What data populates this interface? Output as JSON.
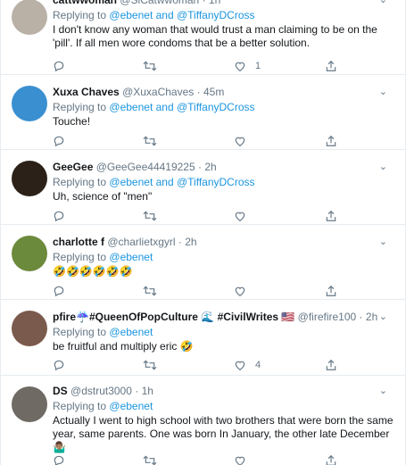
{
  "tweets": [
    {
      "name": "cattwwoman",
      "handle": "@SiCatwwoman",
      "time": "1h",
      "reply_prefix": "Replying to",
      "reply_mentions": "@ebenet and @TiffanyDCross",
      "text": "I don't know any woman that would trust a man claiming to be on the 'pill'. If all men wore condoms that be a better solution.",
      "likes": "1",
      "avatar_color": "#b9b0a6"
    },
    {
      "name": "Xuxa Chaves",
      "handle": "@XuxaChaves",
      "time": "45m",
      "reply_prefix": "Replying to",
      "reply_mentions": "@ebenet and @TiffanyDCross",
      "text": "Touche!",
      "likes": "",
      "avatar_color": "#3a8fd0"
    },
    {
      "name": "GeeGee",
      "handle": "@GeeGee44419225",
      "time": "2h",
      "reply_prefix": "Replying to",
      "reply_mentions": "@ebenet and @TiffanyDCross",
      "text": "Uh, science of \"men\"",
      "likes": "",
      "avatar_color": "#2b2118"
    },
    {
      "name": "charlotte f",
      "handle": "@charlietxgyrl",
      "time": "2h",
      "reply_prefix": "Replying to",
      "reply_mentions": "@ebenet",
      "text": "🤣🤣🤣🤣🤣🤣",
      "likes": "",
      "avatar_color": "#6c8a3c"
    },
    {
      "name": "pfire☔️#QueenOfPopCulture 🌊 #CivilWrites 🇺🇸",
      "handle": "@firefire100",
      "time": "2h",
      "reply_prefix": "Replying to",
      "reply_mentions": "@ebenet",
      "text": "be fruitful and multiply eric 🤣",
      "likes": "4",
      "avatar_color": "#7a5a4c"
    },
    {
      "name": "DS",
      "handle": "@dstrut3000",
      "time": "1h",
      "reply_prefix": "Replying to",
      "reply_mentions": "@ebenet",
      "text": "Actually I went to high school with two brothers that were born the same year, same parents. One was born In January, the other late December 🤷🏽‍♂️",
      "likes": "",
      "avatar_color": "#6f6a63"
    }
  ],
  "accent": "#1b95e0",
  "muted": "#657786"
}
